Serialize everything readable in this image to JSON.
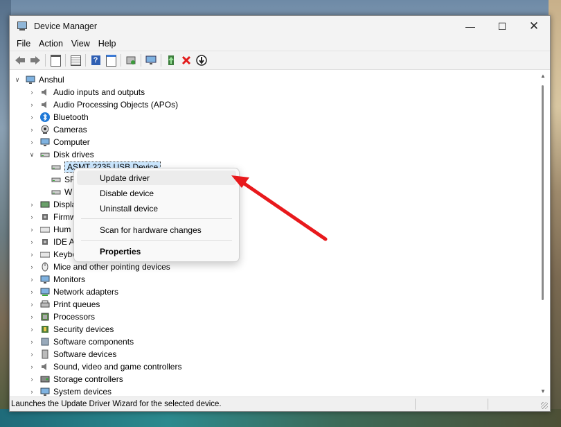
{
  "window": {
    "title": "Device Manager",
    "controls": {
      "minimize": "—",
      "maximize": "☐",
      "close": "✕"
    }
  },
  "menu": [
    "File",
    "Action",
    "View",
    "Help"
  ],
  "tree": {
    "root": "Anshul",
    "categories": [
      {
        "label": "Audio inputs and outputs",
        "icon": "speaker-icon",
        "expanded": false
      },
      {
        "label": "Audio Processing Objects (APOs)",
        "icon": "speaker-icon",
        "expanded": false
      },
      {
        "label": "Bluetooth",
        "icon": "bluetooth-icon",
        "expanded": false
      },
      {
        "label": "Cameras",
        "icon": "camera-icon",
        "expanded": false
      },
      {
        "label": "Computer",
        "icon": "monitor-icon",
        "expanded": false
      },
      {
        "label": "Disk drives",
        "icon": "disk-icon",
        "expanded": true
      },
      {
        "label": "ASMT 2235 USB Device",
        "icon": "disk-icon",
        "child": true,
        "selected": true
      },
      {
        "label": "SP",
        "icon": "disk-icon",
        "child": true
      },
      {
        "label": "W",
        "icon": "disk-icon",
        "child": true
      },
      {
        "label": "Displa",
        "icon": "display-adapter-icon",
        "expanded": false
      },
      {
        "label": "Firmw",
        "icon": "chip-icon",
        "expanded": false
      },
      {
        "label": "Hum",
        "icon": "keyboard-icon",
        "expanded": false
      },
      {
        "label": "IDE A",
        "icon": "chip-icon",
        "expanded": false
      },
      {
        "label": "Keybo",
        "icon": "keyboard-icon",
        "expanded": false
      },
      {
        "label": "Mice and other pointing devices",
        "icon": "mouse-icon",
        "expanded": false
      },
      {
        "label": "Monitors",
        "icon": "monitor-icon",
        "expanded": false
      },
      {
        "label": "Network adapters",
        "icon": "network-icon",
        "expanded": false
      },
      {
        "label": "Print queues",
        "icon": "printer-icon",
        "expanded": false
      },
      {
        "label": "Processors",
        "icon": "cpu-icon",
        "expanded": false
      },
      {
        "label": "Security devices",
        "icon": "security-icon",
        "expanded": false
      },
      {
        "label": "Software components",
        "icon": "component-icon",
        "expanded": false
      },
      {
        "label": "Software devices",
        "icon": "device-icon",
        "expanded": false
      },
      {
        "label": "Sound, video and game controllers",
        "icon": "speaker-icon",
        "expanded": false
      },
      {
        "label": "Storage controllers",
        "icon": "storage-icon",
        "expanded": false
      },
      {
        "label": "System devices",
        "icon": "monitor-icon",
        "expanded": false
      }
    ]
  },
  "context_menu": {
    "items": [
      "Update driver",
      "Disable device",
      "Uninstall device",
      "Scan for hardware changes",
      "Properties"
    ]
  },
  "status": {
    "text": "Launches the Update Driver Wizard for the selected device."
  },
  "colors": {
    "annotation_arrow": "#e8191c",
    "selection": "#cce8ff"
  }
}
